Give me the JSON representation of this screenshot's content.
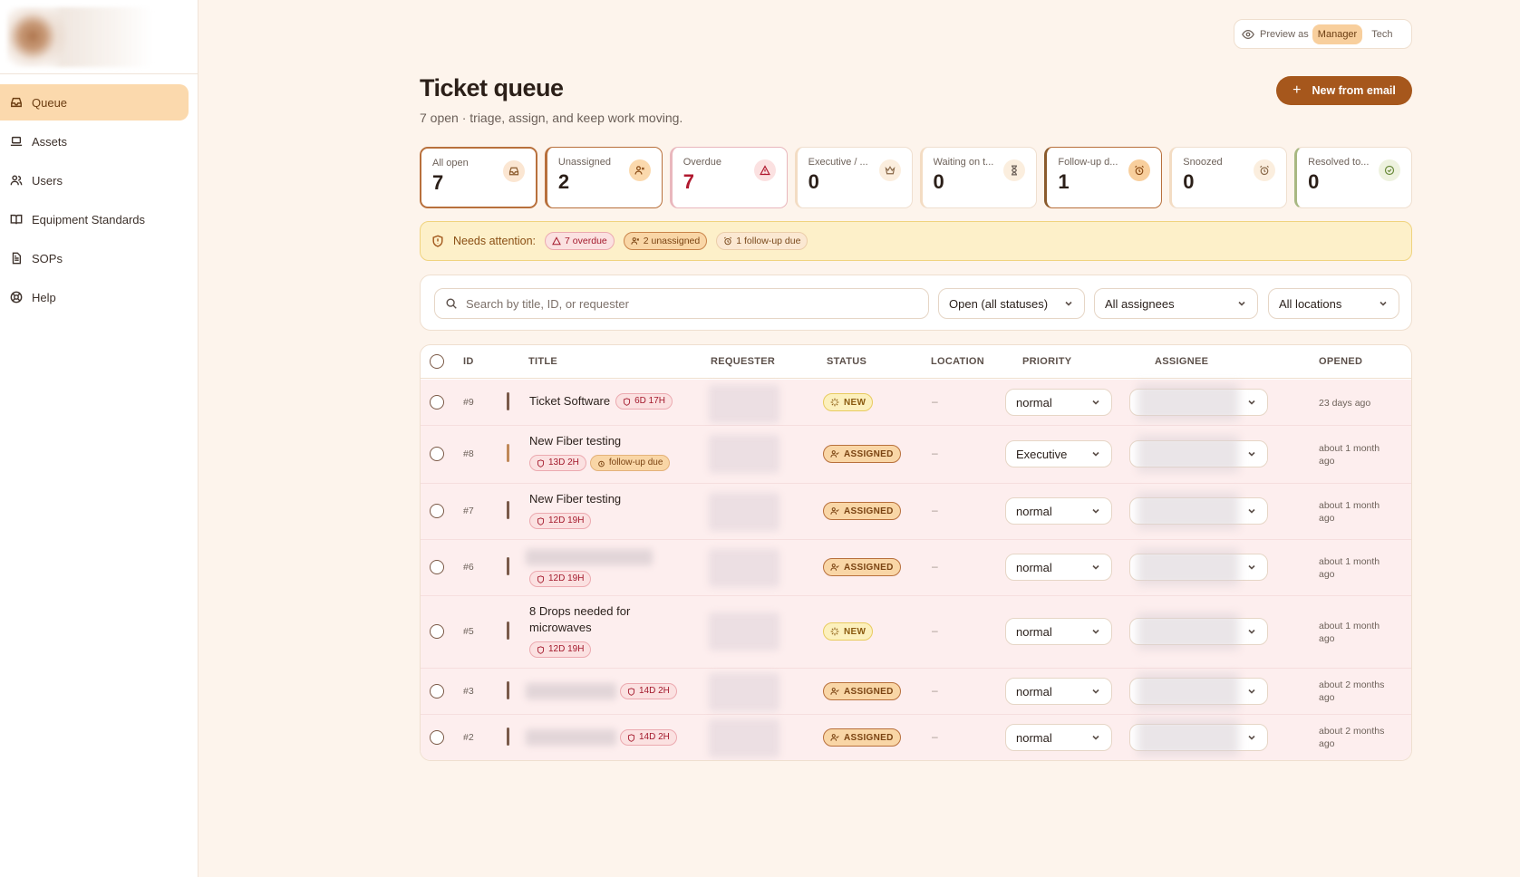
{
  "sidebar": {
    "items": [
      {
        "label": "Queue",
        "icon": "inbox-icon",
        "active": true
      },
      {
        "label": "Assets",
        "icon": "laptop-icon"
      },
      {
        "label": "Users",
        "icon": "users-icon"
      },
      {
        "label": "Equipment Standards",
        "icon": "book-icon"
      },
      {
        "label": "SOPs",
        "icon": "document-icon"
      },
      {
        "label": "Help",
        "icon": "lifebuoy-icon"
      }
    ]
  },
  "preview": {
    "label": "Preview as",
    "options": [
      "Manager",
      "Tech"
    ],
    "selected": "Manager"
  },
  "header": {
    "title": "Ticket queue",
    "subtitle": "7 open · triage, assign, and keep work moving.",
    "new_button": "New from email"
  },
  "stats": [
    {
      "label": "All open",
      "value": "7",
      "icon": "inbox-icon"
    },
    {
      "label": "Unassigned",
      "value": "2",
      "icon": "user-x-icon"
    },
    {
      "label": "Overdue",
      "value": "7",
      "icon": "alert-triangle-icon"
    },
    {
      "label": "Executive / ...",
      "value": "0",
      "icon": "crown-icon"
    },
    {
      "label": "Waiting on t...",
      "value": "0",
      "icon": "hourglass-icon"
    },
    {
      "label": "Follow-up d...",
      "value": "1",
      "icon": "alarm-clock-icon"
    },
    {
      "label": "Snoozed",
      "value": "0",
      "icon": "alarm-clock-icon"
    },
    {
      "label": "Resolved to...",
      "value": "0",
      "icon": "check-circle-icon"
    }
  ],
  "attention": {
    "label": "Needs attention:",
    "pills": [
      "7 overdue",
      "2 unassigned",
      "1 follow-up due"
    ]
  },
  "filters": {
    "search_placeholder": "Search by title, ID, or requester",
    "status": "Open (all statuses)",
    "assignee": "All assignees",
    "location": "All locations"
  },
  "table": {
    "columns": [
      "ID",
      "TITLE",
      "REQUESTER",
      "STATUS",
      "LOCATION",
      "PRIORITY",
      "ASSIGNEE",
      "OPENED"
    ],
    "rows": [
      {
        "id": "#9",
        "title": "Ticket Software",
        "timer": "6D 17H",
        "status": "NEW",
        "location": "–",
        "priority": "normal",
        "opened": "23 days ago"
      },
      {
        "id": "#8",
        "title": "New Fiber testing",
        "timer": "13D 2H",
        "followup": "follow-up due",
        "status": "ASSIGNED",
        "location": "–",
        "priority": "Executive",
        "opened": "about 1 month ago"
      },
      {
        "id": "#7",
        "title": "New Fiber testing",
        "timer": "12D 19H",
        "status": "ASSIGNED",
        "location": "–",
        "priority": "normal",
        "opened": "about 1 month ago"
      },
      {
        "id": "#6",
        "title": "",
        "timer": "12D 19H",
        "status": "ASSIGNED",
        "location": "–",
        "priority": "normal",
        "opened": "about 1 month ago"
      },
      {
        "id": "#5",
        "title": "8 Drops needed for microwaves",
        "timer": "12D 19H",
        "status": "NEW",
        "location": "–",
        "priority": "normal",
        "opened": "about 1 month ago"
      },
      {
        "id": "#3",
        "title": "",
        "timer": "14D 2H",
        "status": "ASSIGNED",
        "location": "–",
        "priority": "normal",
        "opened": "about 2 months ago"
      },
      {
        "id": "#2",
        "title": "",
        "timer": "14D 2H",
        "status": "ASSIGNED",
        "location": "–",
        "priority": "normal",
        "opened": "about 2 months ago"
      }
    ]
  }
}
